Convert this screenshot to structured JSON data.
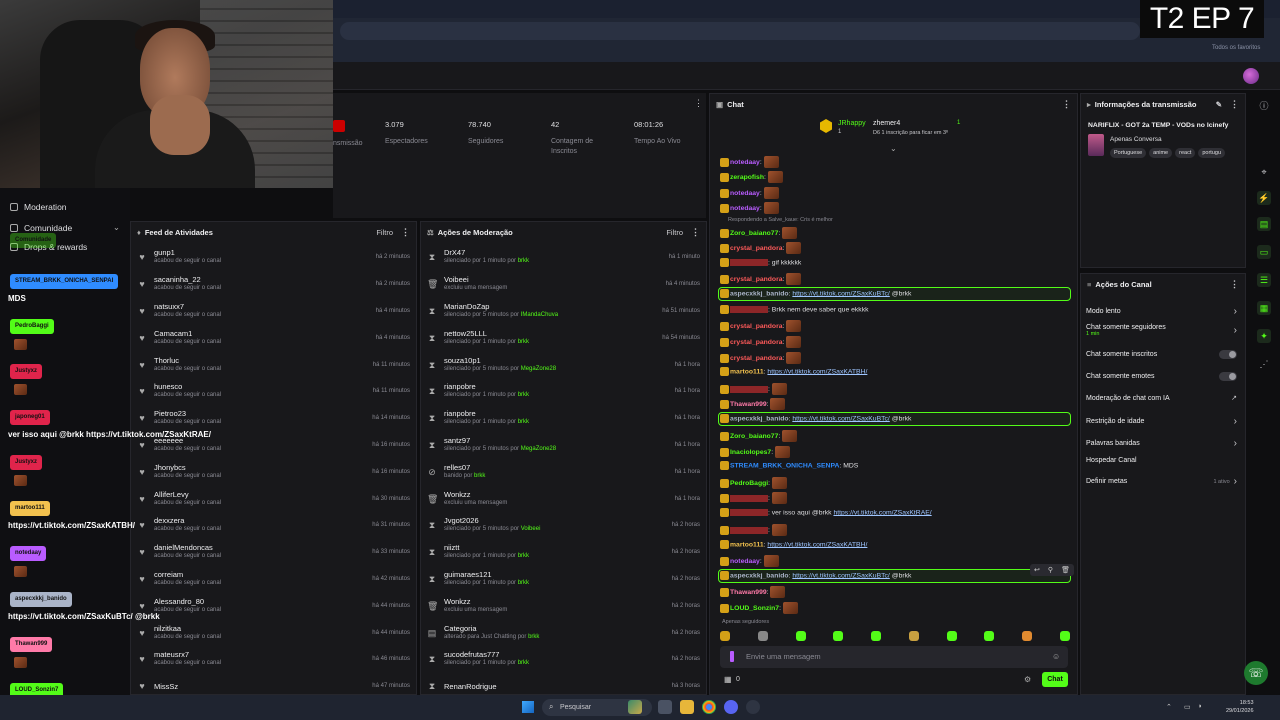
{
  "overlay": {
    "episode": "T2 EP 7"
  },
  "browser": {
    "bookmarks": "Todos os favoritos"
  },
  "nav": {
    "items": [
      "Moderation",
      "Comunidade",
      "Drops & rewards"
    ]
  },
  "stats": [
    {
      "value": "3.079",
      "label": "Espectadores"
    },
    {
      "value": "78.740",
      "label": "Seguidores"
    },
    {
      "value": "42",
      "label": "Contagem de Inscritos"
    },
    {
      "value": "08:01:26",
      "label": "Tempo Ao Vivo"
    }
  ],
  "stats_partial": "nsmissão",
  "activity": {
    "title": "Feed de Atividades",
    "filter": "Filtro",
    "rows": [
      {
        "name": "gunp1",
        "sub": "acabou de seguir o canal",
        "time": "há 2 minutos"
      },
      {
        "name": "sacaninha_22",
        "sub": "acabou de seguir o canal",
        "time": "há 2 minutos"
      },
      {
        "name": "natsuxx7",
        "sub": "acabou de seguir o canal",
        "time": "há 4 minutos"
      },
      {
        "name": "Camacam1",
        "sub": "acabou de seguir o canal",
        "time": "há 4 minutos"
      },
      {
        "name": "Thorluc",
        "sub": "acabou de seguir o canal",
        "time": "há 11 minutos"
      },
      {
        "name": "hunesco",
        "sub": "acabou de seguir o canal",
        "time": "há 11 minutos"
      },
      {
        "name": "Pietroo23",
        "sub": "acabou de seguir o canal",
        "time": "há 14 minutos"
      },
      {
        "name": "eeeeeee",
        "sub": "acabou de seguir o canal",
        "time": "há 16 minutos"
      },
      {
        "name": "Jhonybcs",
        "sub": "acabou de seguir o canal",
        "time": "há 16 minutos"
      },
      {
        "name": "AlliferLevy",
        "sub": "acabou de seguir o canal",
        "time": "há 30 minutos"
      },
      {
        "name": "dexxzera",
        "sub": "acabou de seguir o canal",
        "time": "há 31 minutos"
      },
      {
        "name": "danielMendoncas",
        "sub": "acabou de seguir o canal",
        "time": "há 33 minutos"
      },
      {
        "name": "correiam",
        "sub": "acabou de seguir o canal",
        "time": "há 42 minutos"
      },
      {
        "name": "Alessandro_80",
        "sub": "acabou de seguir o canal",
        "time": "há 44 minutos"
      },
      {
        "name": "nilzitkaa",
        "sub": "acabou de seguir o canal",
        "time": "há 44 minutos"
      },
      {
        "name": "mateusrx7",
        "sub": "acabou de seguir o canal",
        "time": "há 46 minutos"
      },
      {
        "name": "MissSz",
        "sub": "",
        "time": "há 47 minutos"
      }
    ]
  },
  "moderation": {
    "title": "Ações de Moderação",
    "filter": "Filtro",
    "rows": [
      {
        "icon": "⧗",
        "name": "DrX47",
        "sub": "silenciado por 1 minuto por",
        "by": "brkk",
        "time": "há 1 minuto"
      },
      {
        "icon": "🗑",
        "name": "Voibeei",
        "sub": "excluiu uma mensagem",
        "by": "",
        "time": "há 4 minutos"
      },
      {
        "icon": "⧗",
        "name": "MarianDoZap",
        "sub": "silenciado por 5 minutos por",
        "by": "IMandaChuva",
        "time": "há 51 minutos"
      },
      {
        "icon": "⧗",
        "name": "nettow25LLL",
        "sub": "silenciado por 1 minuto por",
        "by": "brkk",
        "time": "há 54 minutos"
      },
      {
        "icon": "⧗",
        "name": "souza10p1",
        "sub": "silenciado por 5 minutos por",
        "by": "MegaZone28",
        "time": "há 1 hora"
      },
      {
        "icon": "⧗",
        "name": "rianpobre",
        "sub": "silenciado por 1 minuto por",
        "by": "brkk",
        "time": "há 1 hora"
      },
      {
        "icon": "⧗",
        "name": "rianpobre",
        "sub": "silenciado por 1 minuto por",
        "by": "brkk",
        "time": "há 1 hora"
      },
      {
        "icon": "⧗",
        "name": "santz97",
        "sub": "silenciado por 5 minutos por",
        "by": "MegaZone28",
        "time": "há 1 hora"
      },
      {
        "icon": "⊘",
        "name": "relles07",
        "sub": "banido por",
        "by": "brkk",
        "time": "há 1 hora"
      },
      {
        "icon": "🗑",
        "name": "Wonkzz",
        "sub": "excluiu uma mensagem",
        "by": "",
        "time": "há 1 hora"
      },
      {
        "icon": "⧗",
        "name": "Jvgot2026",
        "sub": "silenciado por 5 minutos por",
        "by": "Voibeei",
        "time": "há 2 horas"
      },
      {
        "icon": "⧗",
        "name": "niiztt",
        "sub": "silenciado por 1 minuto por",
        "by": "brkk",
        "time": "há 2 horas"
      },
      {
        "icon": "⧗",
        "name": "guimaraes121",
        "sub": "silenciado por 1 minuto por",
        "by": "brkk",
        "time": "há 2 horas"
      },
      {
        "icon": "🗑",
        "name": "Wonkzz",
        "sub": "excluiu uma mensagem",
        "by": "",
        "time": "há 2 horas"
      },
      {
        "icon": "▤",
        "name": "Categoria",
        "sub": "alterado para Just Chatting por",
        "by": "brkk",
        "time": "há 2 horas"
      },
      {
        "icon": "⧗",
        "name": "sucodefrutas777",
        "sub": "silenciado por 1 minuto por",
        "by": "brkk",
        "time": "há 2 horas"
      },
      {
        "icon": "⧗",
        "name": "RenanRodrigue",
        "sub": "",
        "by": "",
        "time": "há 3 horas"
      }
    ]
  },
  "chat": {
    "title": "Chat",
    "pinned": [
      {
        "name": "JRhappy",
        "count": "1"
      },
      {
        "name": "zhemer4",
        "count": "1",
        "sub": "D6 1 inscrição para ficar em 3º"
      }
    ],
    "reply_note": "Respondendo a Salve_kaue: Cris é melhor",
    "following_only": "Apenas seguidores",
    "placeholder": "Envie uma mensagem",
    "count": "0",
    "send": "Chat",
    "messages": [
      {
        "user": "notedaay",
        "color": "#b95cff",
        "text": "",
        "link": "",
        "tail": "",
        "emote": true
      },
      {
        "user": "zerapofish",
        "color": "#53fc18",
        "text": "",
        "link": "",
        "tail": "",
        "emote": true
      },
      {
        "user": "notedaay",
        "color": "#b95cff",
        "text": "",
        "link": "",
        "tail": "",
        "emote": true
      },
      {
        "user": "notedaay",
        "color": "#b95cff",
        "text": "",
        "link": "",
        "tail": "",
        "emote": true
      },
      {
        "user": "Zoro_baiano77",
        "color": "#53fc18",
        "text": "",
        "link": "",
        "tail": "",
        "emote": true
      },
      {
        "user": "crystal_pandora",
        "color": "#ff5a5a",
        "text": "",
        "link": "",
        "tail": "",
        "emote": true
      },
      {
        "user": "",
        "color": "#e33",
        "text": "gif kkkkkk",
        "link": "",
        "tail": "",
        "emote": false
      },
      {
        "user": "crystal_pandora",
        "color": "#ff5a5a",
        "text": "",
        "link": "",
        "tail": "",
        "emote": true
      },
      {
        "user": "aspecxkkj_banido",
        "color": "#aab4c8",
        "text": "",
        "link": "https://vt.tiktok.com/ZSaxKuBTc/",
        "tail": "@brkk",
        "emote": false
      },
      {
        "user": "",
        "color": "#e33",
        "text": "Brkk nem deve saber que ekkkk",
        "link": "",
        "tail": "",
        "emote": false
      },
      {
        "user": "crystal_pandora",
        "color": "#ff5a5a",
        "text": "",
        "link": "",
        "tail": "",
        "emote": true
      },
      {
        "user": "crystal_pandora",
        "color": "#ff5a5a",
        "text": "",
        "link": "",
        "tail": "",
        "emote": true
      },
      {
        "user": "crystal_pandora",
        "color": "#ff5a5a",
        "text": "",
        "link": "",
        "tail": "",
        "emote": true
      },
      {
        "user": "martoo111",
        "color": "#f2c14e",
        "text": "",
        "link": "https://vt.tiktok.com/ZSaxKATBH/",
        "tail": "",
        "emote": false
      },
      {
        "user": "",
        "color": "#e33",
        "text": "",
        "link": "",
        "tail": "",
        "emote": true
      },
      {
        "user": "Thawan999",
        "color": "#ff7aa8",
        "text": "",
        "link": "",
        "tail": "",
        "emote": true
      },
      {
        "user": "aspecxkkj_banido",
        "color": "#aab4c8",
        "text": "",
        "link": "https://vt.tiktok.com/ZSaxKuBTc/",
        "tail": "@brkk",
        "emote": false
      },
      {
        "user": "Zoro_baiano77",
        "color": "#53fc18",
        "text": "",
        "link": "",
        "tail": "",
        "emote": true
      },
      {
        "user": "Inaciolopes7",
        "color": "#53fc18",
        "text": "",
        "link": "",
        "tail": "",
        "emote": true
      },
      {
        "user": "STREAM_BRKK_ONICHA_SENPA",
        "color": "#2f8cff",
        "text": "MDS",
        "link": "",
        "tail": "",
        "emote": false
      },
      {
        "user": "PedroBaggi",
        "color": "#53fc18",
        "text": "",
        "link": "",
        "tail": "",
        "emote": true
      },
      {
        "user": "",
        "color": "#e33",
        "text": "",
        "link": "",
        "tail": "",
        "emote": true
      },
      {
        "user": "",
        "color": "#e33",
        "text": "ver isso aqui @brkk",
        "link": "https://vt.tiktok.com/ZSaxKtRAE/",
        "tail": "",
        "emote": false
      },
      {
        "user": "",
        "color": "#e33",
        "text": "",
        "link": "",
        "tail": "",
        "emote": true
      },
      {
        "user": "martoo111",
        "color": "#f2c14e",
        "text": "",
        "link": "https://vt.tiktok.com/ZSaxKATBH/",
        "tail": "",
        "emote": false
      },
      {
        "user": "notedaay",
        "color": "#b95cff",
        "text": "",
        "link": "",
        "tail": "",
        "emote": true
      },
      {
        "user": "aspecxkkj_banido",
        "color": "#aab4c8",
        "text": "",
        "link": "https://vt.tiktok.com/ZSaxKuBTc/",
        "tail": "@brkk",
        "emote": false
      },
      {
        "user": "Thawan999",
        "color": "#ff7aa8",
        "text": "",
        "link": "",
        "tail": "",
        "emote": true
      },
      {
        "user": "LOUD_Sonzin7",
        "color": "#53fc18",
        "text": "",
        "link": "",
        "tail": "",
        "emote": true
      }
    ]
  },
  "info": {
    "title": "Informações da transmissão",
    "stream_title": "NARIFLIX - GOT 2a TEMP - VODs no Icinefy",
    "category": "Apenas Conversa",
    "tags": [
      "Portuguese",
      "anime",
      "react",
      "portugu"
    ]
  },
  "actions": {
    "title": "Ações do Canal",
    "items": [
      {
        "label": "Modo lento",
        "kind": "chev"
      },
      {
        "label": "Chat somente seguidores",
        "sub": "1 min",
        "kind": "chev"
      },
      {
        "label": "Chat somente inscritos",
        "kind": "toggle"
      },
      {
        "label": "Chat somente emotes",
        "kind": "toggle"
      },
      {
        "label": "Moderação de chat com IA",
        "kind": "ext"
      },
      {
        "label": "Restrição de idade",
        "kind": "chev"
      },
      {
        "label": "Palavras banidas",
        "kind": "chev"
      },
      {
        "label": "Hospedar Canal",
        "kind": "none"
      },
      {
        "label": "Definir metas",
        "badge": "1 ativo",
        "kind": "chev"
      }
    ]
  },
  "overlay_chat": [
    {
      "name": "Comunidade",
      "color": "#53fc18",
      "msg": ""
    },
    {
      "name": "STREAM_BRKK_ONICHA_SENPAI",
      "color": "#2f8cff",
      "msg": "MDS"
    },
    {
      "name": "PedroBaggi",
      "color": "#53fc18",
      "msg": ""
    },
    {
      "name": "Justyxz",
      "color": "#e0244b",
      "msg": ""
    },
    {
      "name": "japoneg01",
      "color": "#e0244b",
      "msg": "ver isso aqui @brkk https://vt.tiktok.com/ZSaxKtRAE/"
    },
    {
      "name": "Justyxz",
      "color": "#e0244b",
      "msg": ""
    },
    {
      "name": "martoo111",
      "color": "#f2c14e",
      "msg": "https://vt.tiktok.com/ZSaxKATBH/"
    },
    {
      "name": "notedaay",
      "color": "#b95cff",
      "msg": ""
    },
    {
      "name": "aspecxkkj_banido",
      "color": "#aab4c8",
      "msg": "https://vt.tiktok.com/ZSaxKuBTc/ @brkk"
    },
    {
      "name": "Thawan999",
      "color": "#ff7aa8",
      "msg": ""
    },
    {
      "name": "LOUD_Sonzin7",
      "color": "#53fc18",
      "msg": ""
    }
  ],
  "taskbar": {
    "search": "Pesquisar",
    "time": "18:53",
    "date": "29/01/2026"
  }
}
